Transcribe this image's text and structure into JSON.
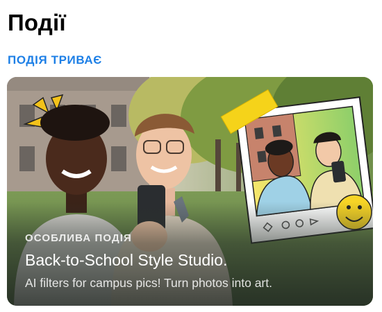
{
  "header": {
    "title": "Події"
  },
  "section": {
    "status": "ПОДІЯ ТРИВАЄ"
  },
  "event_card": {
    "kicker": "ОСОБЛИВА ПОДІЯ",
    "title": "Back-to-School Style Studio.",
    "subtitle": "AI filters for campus pics! Turn photos into art."
  },
  "colors": {
    "accent": "#1d7fe6",
    "highlight": "#f5d31a"
  }
}
